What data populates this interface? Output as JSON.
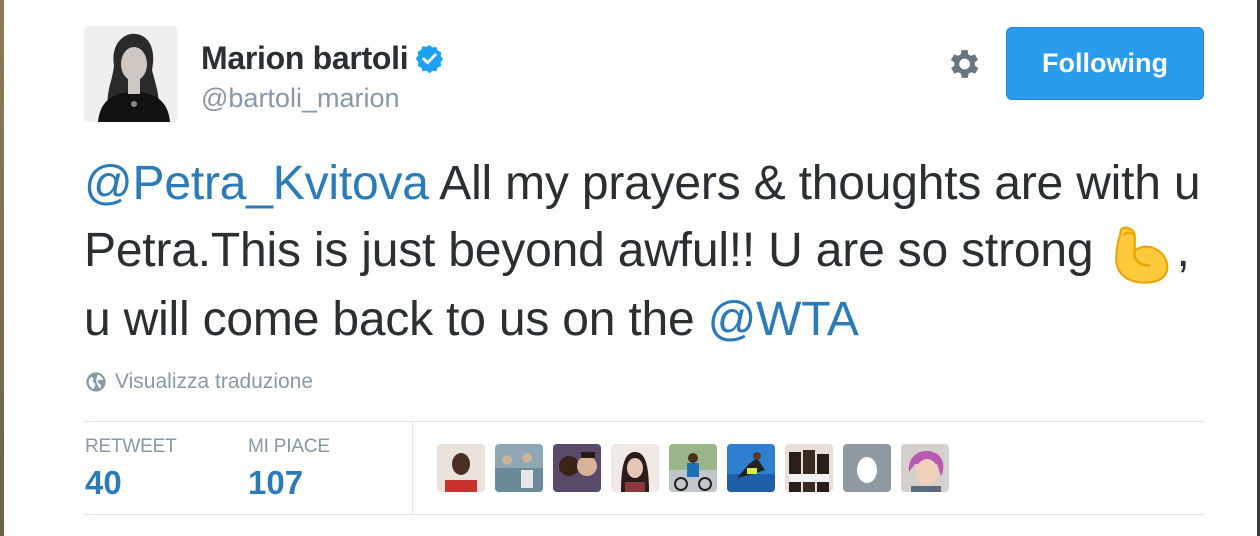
{
  "profile": {
    "name": "Marion bartoli",
    "handle": "@bartoli_marion",
    "verified": true,
    "avatar_icon": "profile-photo",
    "follow_label": "Following",
    "settings_icon": "gear-icon"
  },
  "tweet": {
    "mention1": "@Petra_Kvitova",
    "text1": " All my prayers & thoughts are with u Petra.This is just beyond awful!! U are so strong ",
    "emoji": "flexed-biceps-icon",
    "text2": ", u will come back to us on the ",
    "mention2": "@WTA"
  },
  "translate": {
    "icon": "globe-icon",
    "label": "Visualizza traduzione"
  },
  "stats": {
    "retweet_label": "RETWEET",
    "retweet_count": "40",
    "like_label": "MI PIACE",
    "like_count": "107"
  },
  "likers": [
    {
      "icon": "user-avatar",
      "color": "#d7d0c8"
    },
    {
      "icon": "user-avatar",
      "color": "#6f8fa0"
    },
    {
      "icon": "user-avatar",
      "color": "#3a3340"
    },
    {
      "icon": "user-avatar",
      "color": "#d9c5bb"
    },
    {
      "icon": "user-avatar",
      "color": "#7a8e6a"
    },
    {
      "icon": "user-avatar",
      "color": "#2f7fd0"
    },
    {
      "icon": "user-avatar",
      "color": "#3b2f2c"
    },
    {
      "icon": "default-egg-avatar",
      "color": "#8f99a3"
    },
    {
      "icon": "user-avatar",
      "color": "#b06fa8"
    }
  ],
  "colors": {
    "link": "#2b7bb9",
    "button": "#2b9bec",
    "muted": "#8899a6",
    "text": "#292f33"
  }
}
